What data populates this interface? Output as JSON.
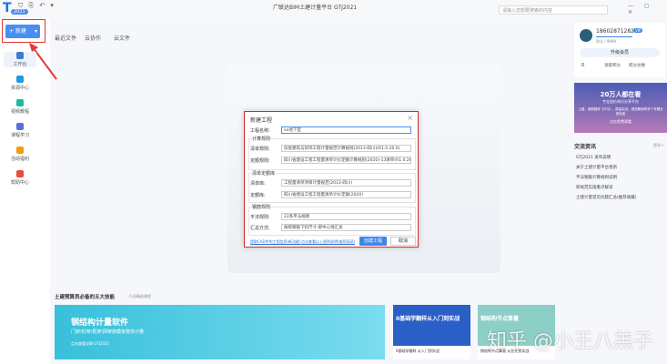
{
  "app": {
    "logo": "T",
    "version": "2021",
    "title": "广联达BIM土建计量平台 GTJ2021",
    "quick_access": "⛉ ⎘ ↶ ▾",
    "search_placeholder": "请输入您想要搜索的内容",
    "window_controls": "— ▢ ✕"
  },
  "toolbar": {
    "new_label": "+ 新建",
    "new_dropdown": "▾"
  },
  "tabs": [
    {
      "label": "最近文件"
    },
    {
      "label": "云协作"
    },
    {
      "label": "云文件"
    }
  ],
  "sidebar": {
    "items": [
      {
        "label": "工作台",
        "icon": "grid-icon",
        "color": "#3a7bd5"
      },
      {
        "label": "资源中心",
        "icon": "layers-icon",
        "color": "#1e9be0"
      },
      {
        "label": "视频教程",
        "icon": "star-icon",
        "color": "#1abc9c"
      },
      {
        "label": "课程学习",
        "icon": "tv-icon",
        "color": "#5b6ee1"
      },
      {
        "label": "活动福利",
        "icon": "gift-icon",
        "color": "#f39c12"
      },
      {
        "label": "帮助中心",
        "icon": "bell-icon",
        "color": "#e74c3c"
      }
    ]
  },
  "dialog": {
    "title": "新建工程",
    "close": "×",
    "project_name_label": "工程名称:",
    "project_name": "xx地下室",
    "group_rules": "计算规则",
    "bill_rule_label": "清单规则:",
    "bill_rule": "房屋建筑与装饰工程计量规范计算规则(2013-四川)(R1.0.26.0)",
    "quota_rule_label": "定额规则:",
    "quota_rule": "四川省建设工程工程量清单计价定额计算规则(2020)-13清单(R1.0.26.0)",
    "group_lib": "清单定额库",
    "bill_lib_label": "清单库:",
    "bill_lib": "工程量清单项目计量规范(2013-四川)",
    "quota_lib_label": "定额库:",
    "quota_lib": "四川省建设工程工程量清单计价定额(2020)",
    "group_rebar": "钢筋规则",
    "flat_rule_label": "平法规则:",
    "flat_rule": "22系平法规则",
    "summary_label": "汇总方式:",
    "summary": "按照钢筋下料尺寸-即中心线汇总",
    "link1": "提取CAD中的工程信息(新功能)",
    "link2": "点击查看以上规则说明(推荐阅读)",
    "create": "创建工程",
    "cancel": "取消"
  },
  "user": {
    "phone": "18602871282",
    "badge": "VIP",
    "sub": "积分 / 9999",
    "upgrade": "升级会员",
    "coins": "0",
    "link1": "领取积分",
    "link2": "积分兑换"
  },
  "ad": {
    "title": "20万人都在看",
    "sub": "专业造价知识分享平台",
    "body": "土建、钢筋翻样【GTJ】、算量实战、规范解读等多个专题全部免费",
    "btn": "点击免费观看"
  },
  "news": {
    "title": "交流资讯",
    "more": "更多>",
    "items": [
      "GTJ2021 发布说明",
      "关于土建计量平台更新",
      "平法钢筋计算规则说明",
      "新规范实施重点解读",
      "土建计量常见问题汇总(推荐收藏)"
    ]
  },
  "bottom": {
    "section_title": "土建预算员必备的五大技能",
    "section_sub": "行业精选课程",
    "banner_title": "钢结构计量软件",
    "banner_sub": "门架\\桁架\\框架\\网架族模板整体计量",
    "banner_note": "点击查看详情 GTJ2021",
    "cards": [
      {
        "title": "0基础学翻样从入门到实战",
        "caption": "0基础学翻样 从入门到实战"
      },
      {
        "title": "钢结构节点算量",
        "caption": "钢结构节点算量 从业先到实战"
      }
    ]
  },
  "watermark": "知乎 @小王八羔子",
  "colors": {
    "accent": "#4a8ff0",
    "highlight": "#e53935"
  }
}
